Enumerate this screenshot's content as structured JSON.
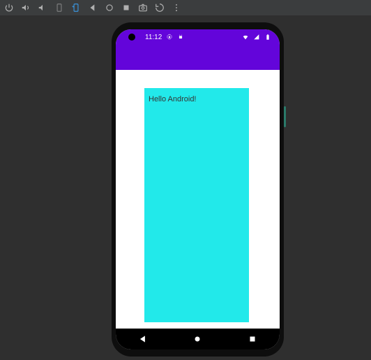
{
  "emulator_toolbar": {
    "icons": {
      "power": "power-icon",
      "vol_up": "volume-up-icon",
      "vol_down": "volume-down-icon",
      "rotate_left": "rotate-left-icon",
      "rotate_right": "rotate-right-icon",
      "back": "back-icon",
      "home": "home-icon",
      "overview": "overview-icon",
      "screenshot": "camera-icon",
      "record": "record-icon",
      "more": "more-icon"
    }
  },
  "status_bar": {
    "time": "11:12",
    "left_icons": [
      "settings-gear-icon",
      "android-icon"
    ],
    "right_icons": [
      "wifi-icon",
      "signal-icon",
      "battery-icon"
    ]
  },
  "app": {
    "bar_color": "#6305da",
    "body_text": "Hello Android!",
    "box_color": "#22e9ea"
  },
  "nav": {
    "back": "◀",
    "home": "●",
    "recent": "■"
  }
}
